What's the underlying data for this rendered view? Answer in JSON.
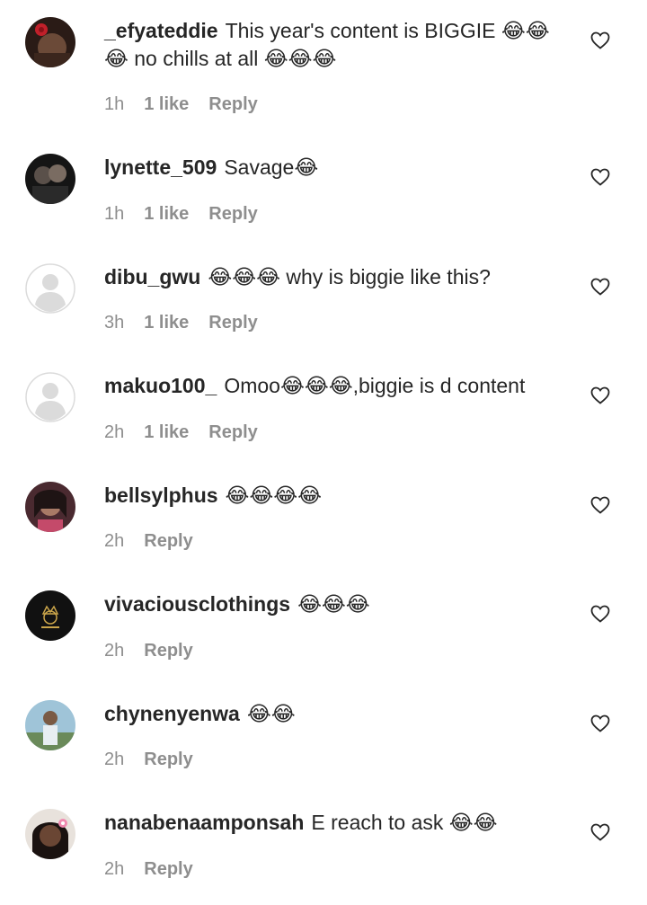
{
  "comments": [
    {
      "username": "_efyateddie",
      "text": "This year's content is BIGGIE 😂😂😂 no chills at all 😂😂😂",
      "time": "1h",
      "likes": "1 like",
      "reply": "Reply",
      "avatar_icon": "avatar-rose-photo"
    },
    {
      "username": "lynette_509",
      "text": "Savage😂",
      "time": "1h",
      "likes": "1 like",
      "reply": "Reply",
      "avatar_icon": "avatar-two-faces-photo"
    },
    {
      "username": "dibu_gwu",
      "text": "😂😂😂 why is biggie like this?",
      "time": "3h",
      "likes": "1 like",
      "reply": "Reply",
      "avatar_icon": "default-avatar-icon"
    },
    {
      "username": "makuo100_",
      "text": "Omoo😂😂😂,biggie is d content",
      "time": "2h",
      "likes": "1 like",
      "reply": "Reply",
      "avatar_icon": "default-avatar-icon"
    },
    {
      "username": "bellsylphus",
      "text": "😂😂😂😂",
      "time": "2h",
      "likes": "",
      "reply": "Reply",
      "avatar_icon": "avatar-portrait-photo"
    },
    {
      "username": "vivaciousclothings",
      "text": "😂😂😂",
      "time": "2h",
      "likes": "",
      "reply": "Reply",
      "avatar_icon": "avatar-brand-logo"
    },
    {
      "username": "chynenyenwa",
      "text": "😂😂",
      "time": "2h",
      "likes": "",
      "reply": "Reply",
      "avatar_icon": "avatar-outdoor-photo"
    },
    {
      "username": "nanabenaamponsah",
      "text": "E reach to ask 😂😂",
      "time": "2h",
      "likes": "",
      "reply": "Reply",
      "avatar_icon": "avatar-portrait-flower-photo"
    }
  ],
  "colors": {
    "text": "#262626",
    "meta": "#8e8e8e",
    "default_avatar_bg": "#dbdbdb"
  }
}
